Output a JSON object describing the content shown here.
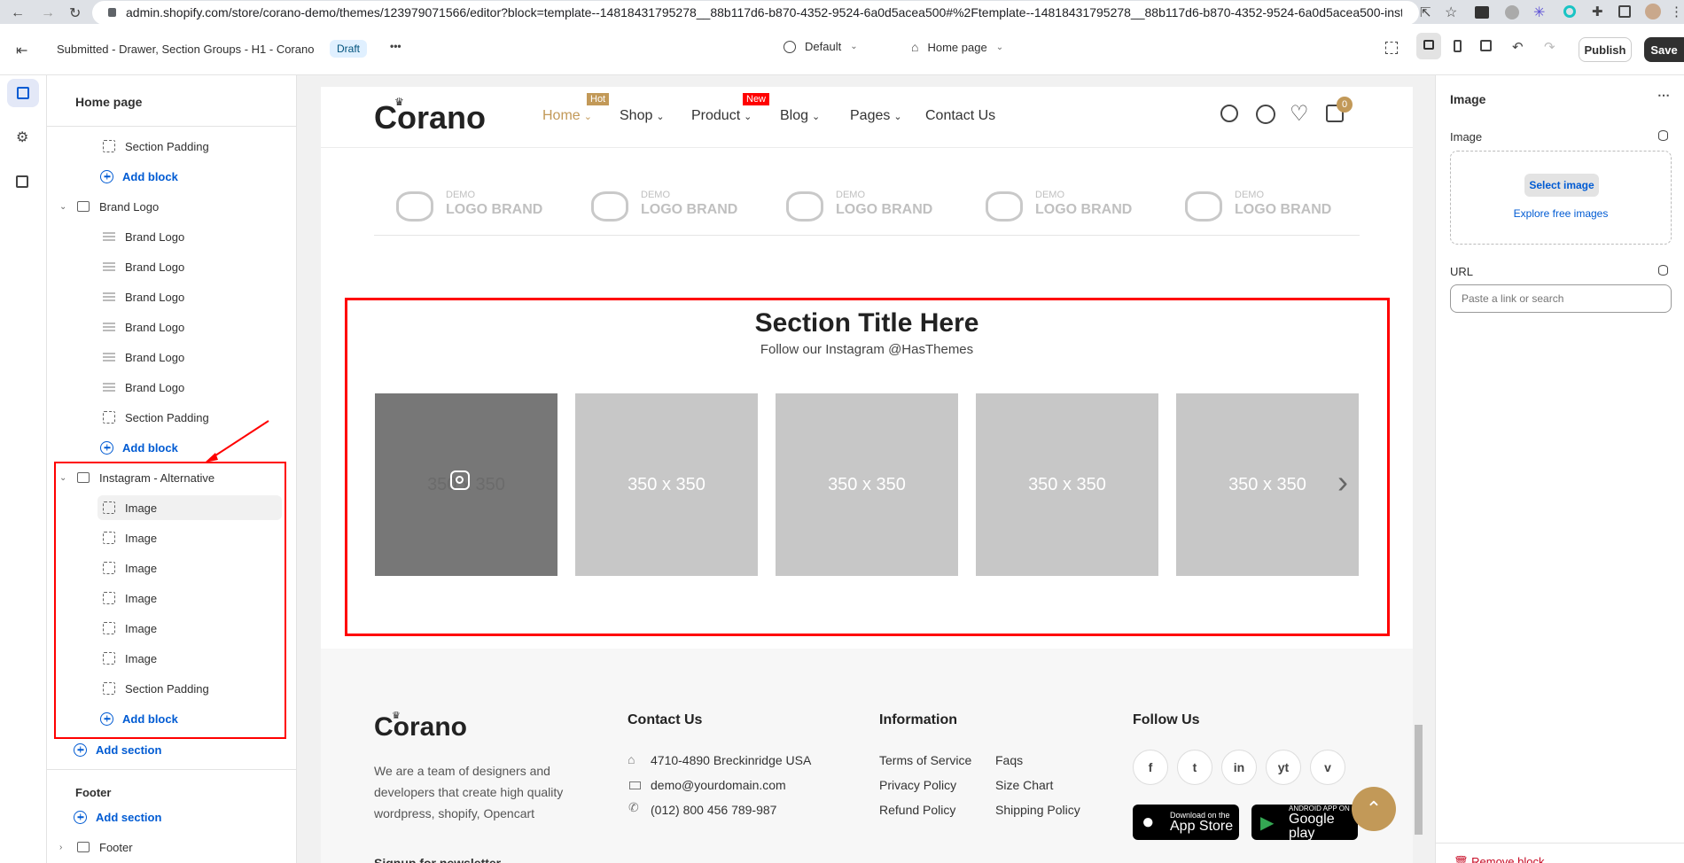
{
  "browser": {
    "url": "admin.shopify.com/store/corano-demo/themes/123979071566/editor?block=template--14818431795278__88b117d6-b870-4352-9524-6a0d5acea500#%2Ftemplate--14818431795278__88b117d6-b870-4352-9524-6a0d5acea500-inst..."
  },
  "topbar": {
    "theme_title": "Submitted - Drawer, Section Groups - H1 - Corano",
    "draft_badge": "Draft",
    "more": "•••",
    "locale": "Default",
    "page": "Home page",
    "publish": "Publish",
    "save": "Save"
  },
  "left_panel": {
    "title": "Home page",
    "rows": [
      {
        "type": "block",
        "label": "Section Padding"
      },
      {
        "type": "add",
        "label": "Add block"
      },
      {
        "type": "section",
        "label": "Brand Logo"
      },
      {
        "type": "logo",
        "label": "Brand Logo"
      },
      {
        "type": "logo",
        "label": "Brand Logo"
      },
      {
        "type": "logo",
        "label": "Brand Logo"
      },
      {
        "type": "logo",
        "label": "Brand Logo"
      },
      {
        "type": "logo",
        "label": "Brand Logo"
      },
      {
        "type": "logo",
        "label": "Brand Logo"
      },
      {
        "type": "block",
        "label": "Section Padding"
      },
      {
        "type": "add",
        "label": "Add block"
      },
      {
        "type": "section",
        "label": "Instagram - Alternative"
      },
      {
        "type": "block",
        "label": "Image",
        "selected": true
      },
      {
        "type": "block",
        "label": "Image"
      },
      {
        "type": "block",
        "label": "Image"
      },
      {
        "type": "block",
        "label": "Image"
      },
      {
        "type": "block",
        "label": "Image"
      },
      {
        "type": "block",
        "label": "Image"
      },
      {
        "type": "block",
        "label": "Section Padding"
      },
      {
        "type": "add",
        "label": "Add block"
      }
    ],
    "add_section_label": "Add section",
    "footer_group_title": "Footer",
    "footer_add_section": "Add section",
    "footer_section": "Footer"
  },
  "preview": {
    "logo": "Corano",
    "nav": [
      {
        "label": "Home",
        "badge": "Hot",
        "badge_color": "#c29958",
        "active": true,
        "chevron": true
      },
      {
        "label": "Shop",
        "chevron": true
      },
      {
        "label": "Product",
        "badge": "New",
        "badge_color": "#ff0000",
        "chevron": true
      },
      {
        "label": "Blog",
        "chevron": true
      },
      {
        "label": "Pages",
        "chevron": true
      },
      {
        "label": "Contact Us"
      }
    ],
    "cart_count": "0",
    "brands": [
      {
        "demo": "DEMO",
        "name": "LOGO BRAND",
        "icon": "os-letters-icon"
      },
      {
        "demo": "DEMO",
        "name": "LOGO BRAND",
        "icon": "knight-icon"
      },
      {
        "demo": "DEMO",
        "name": "LOGO BRAND",
        "icon": "bicycle-icon"
      },
      {
        "demo": "DEMO",
        "name": "LOGO BRAND",
        "icon": "dribbble-icon"
      },
      {
        "demo": "DEMO",
        "name": "LOGO BRAND",
        "icon": "cloud-icon"
      }
    ],
    "section_title": "Section Title Here",
    "section_subtitle": "Follow our Instagram @HasThemes",
    "images": [
      "350 x 350",
      "350 x 350",
      "350 x 350",
      "350 x 350",
      "350 x 350"
    ],
    "footer": {
      "logo": "Corano",
      "about": [
        "We are a team of designers and",
        "developers that create high quality",
        "wordpress, shopify, Opencart"
      ],
      "contact_title": "Contact Us",
      "contact": [
        "4710-4890 Breckinridge USA",
        "demo@yourdomain.com",
        "(012) 800 456 789-987"
      ],
      "info_title": "Information",
      "info_col1": [
        "Terms of Service",
        "Privacy Policy",
        "Refund Policy"
      ],
      "info_col2": [
        "Faqs",
        "Size Chart",
        "Shipping Policy"
      ],
      "follow_title": "Follow Us",
      "social": [
        "f",
        "t",
        "in",
        "yt",
        "v"
      ],
      "appstore_small": "Download on the",
      "appstore_big": "App Store",
      "gplay_small": "ANDROID APP ON",
      "gplay_big": "Google play",
      "newsletter": "Signup for newsletter"
    }
  },
  "right_panel": {
    "title": "Image",
    "image_label": "Image",
    "select_image": "Select image",
    "explore": "Explore free images",
    "url_label": "URL",
    "url_placeholder": "Paste a link or search",
    "remove_block": "Remove block"
  },
  "colors": {
    "accent": "#c29958",
    "annotation": "#ff0000",
    "link_blue": "#005bd3"
  }
}
